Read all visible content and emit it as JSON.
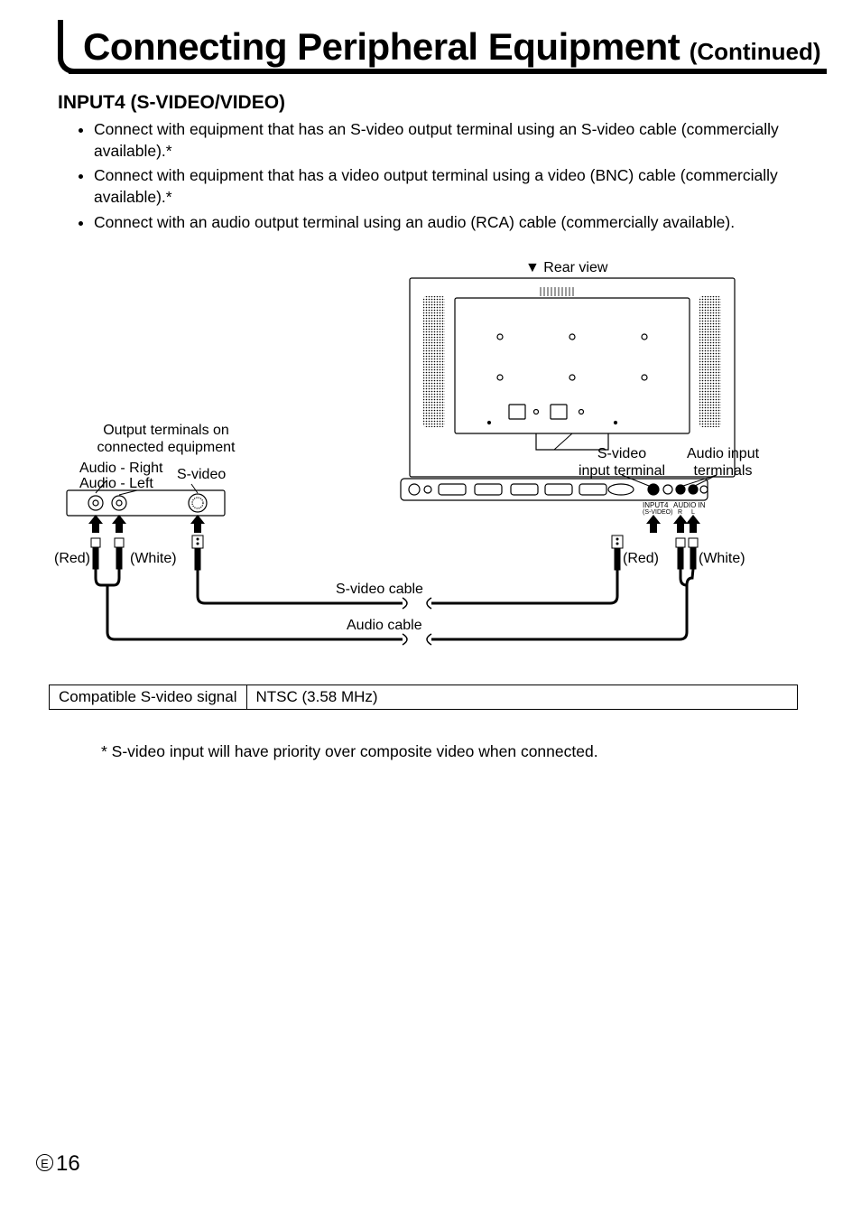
{
  "title": {
    "main": "Connecting Peripheral Equipment",
    "continued": "(Continued)"
  },
  "section": {
    "heading": "INPUT4 (S-VIDEO/VIDEO)",
    "bullets": [
      "Connect with equipment that has an S-video output terminal using an S-video cable (commercially available).*",
      "Connect with equipment that has a video output terminal using a video (BNC) cable (commercially available).*",
      "Connect with an audio output terminal using an audio (RCA) cable (commercially available)."
    ]
  },
  "diagram": {
    "rear_view": "▼ Rear view",
    "output_terminals_line1": "Output terminals on",
    "output_terminals_line2": "connected equipment",
    "audio_right": "Audio - Right",
    "audio_left": "Audio - Left",
    "svideo": "S-video",
    "red": "(Red)",
    "white": "(White)",
    "svideo_cable": "S-video cable",
    "audio_cable": "Audio cable",
    "svideo_input_line1": "S-video",
    "svideo_input_line2": "input terminal",
    "audio_input_line1": "Audio input",
    "audio_input_line2": "terminals",
    "port_input4": "INPUT4",
    "port_svideo": "(S-VIDEO)",
    "port_audioin": "AUDIO IN",
    "port_r": "R",
    "port_l": "L"
  },
  "compat_table": {
    "left": "Compatible S-video signal",
    "right": "NTSC (3.58 MHz)"
  },
  "footnote": "*  S-video input will have priority over composite video when connected.",
  "page_number": {
    "prefix": "E",
    "num": "16"
  }
}
